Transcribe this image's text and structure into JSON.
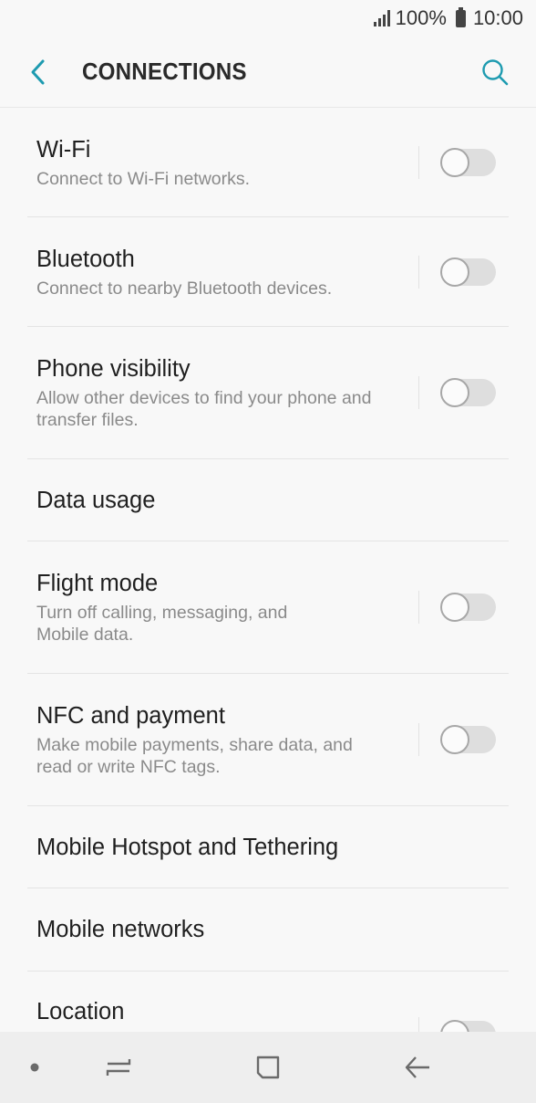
{
  "status_bar": {
    "battery": "100%",
    "time": "10:00"
  },
  "header": {
    "title": "CONNECTIONS"
  },
  "items": [
    {
      "title": "Wi-Fi",
      "subtitle": "Connect to Wi-Fi networks.",
      "toggle": false
    },
    {
      "title": "Bluetooth",
      "subtitle": "Connect to nearby Bluetooth devices.",
      "toggle": false
    },
    {
      "title": "Phone visibility",
      "subtitle": "Allow other devices to find your phone and transfer files.",
      "toggle": false
    },
    {
      "title": "Data usage"
    },
    {
      "title": "Flight mode",
      "subtitle": "Turn off calling, messaging, and Mobile data.",
      "toggle": false
    },
    {
      "title": "NFC and payment",
      "subtitle": "Make mobile payments, share data, and read or write NFC tags.",
      "toggle": false
    },
    {
      "title": "Mobile Hotspot and Tethering"
    },
    {
      "title": "Mobile networks"
    },
    {
      "title": "Location",
      "toggle": false
    }
  ],
  "colors": {
    "accent": "#1e9bb0",
    "background": "#f8f8f8",
    "nav_bar": "#eeeeee"
  }
}
